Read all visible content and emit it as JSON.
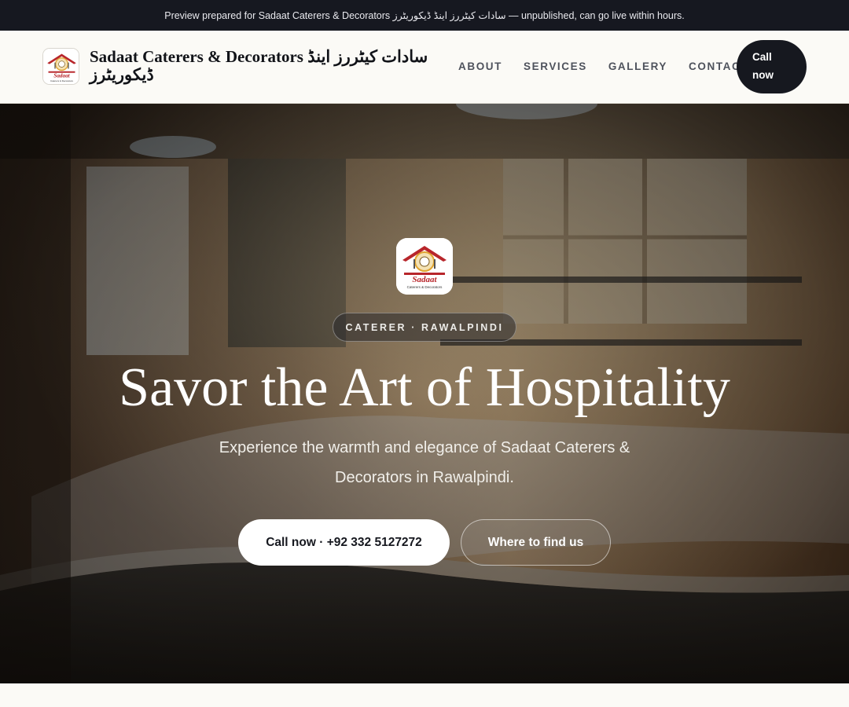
{
  "banner": {
    "text": "Preview prepared for Sadaat Caterers & Decorators سادات کیٹررز اینڈ ڈیکوریٹرز — unpublished, can go live within hours."
  },
  "header": {
    "brand_name": "Sadaat Caterers & Decorators سادات کیٹررز اینڈ ڈیکوریٹرز",
    "logo_text": "Sadaat",
    "logo_subtext": "Caterers & Decorators",
    "nav": [
      {
        "label": "ABOUT"
      },
      {
        "label": "SERVICES"
      },
      {
        "label": "GALLERY"
      },
      {
        "label": "CONTACT"
      }
    ],
    "call_label": "Call now"
  },
  "hero": {
    "eyebrow": "CATERER · RAWALPINDI",
    "title": "Savor the Art of Hospitality",
    "subtitle": "Experience the warmth and elegance of Sadaat Caterers & Decorators in Rawalpindi.",
    "primary_cta": "Call now · +92 332 5127272",
    "secondary_cta": "Where to find us"
  },
  "colors": {
    "dark": "#16181f",
    "logo_red": "#b8262b",
    "logo_gold": "#e0a430"
  }
}
